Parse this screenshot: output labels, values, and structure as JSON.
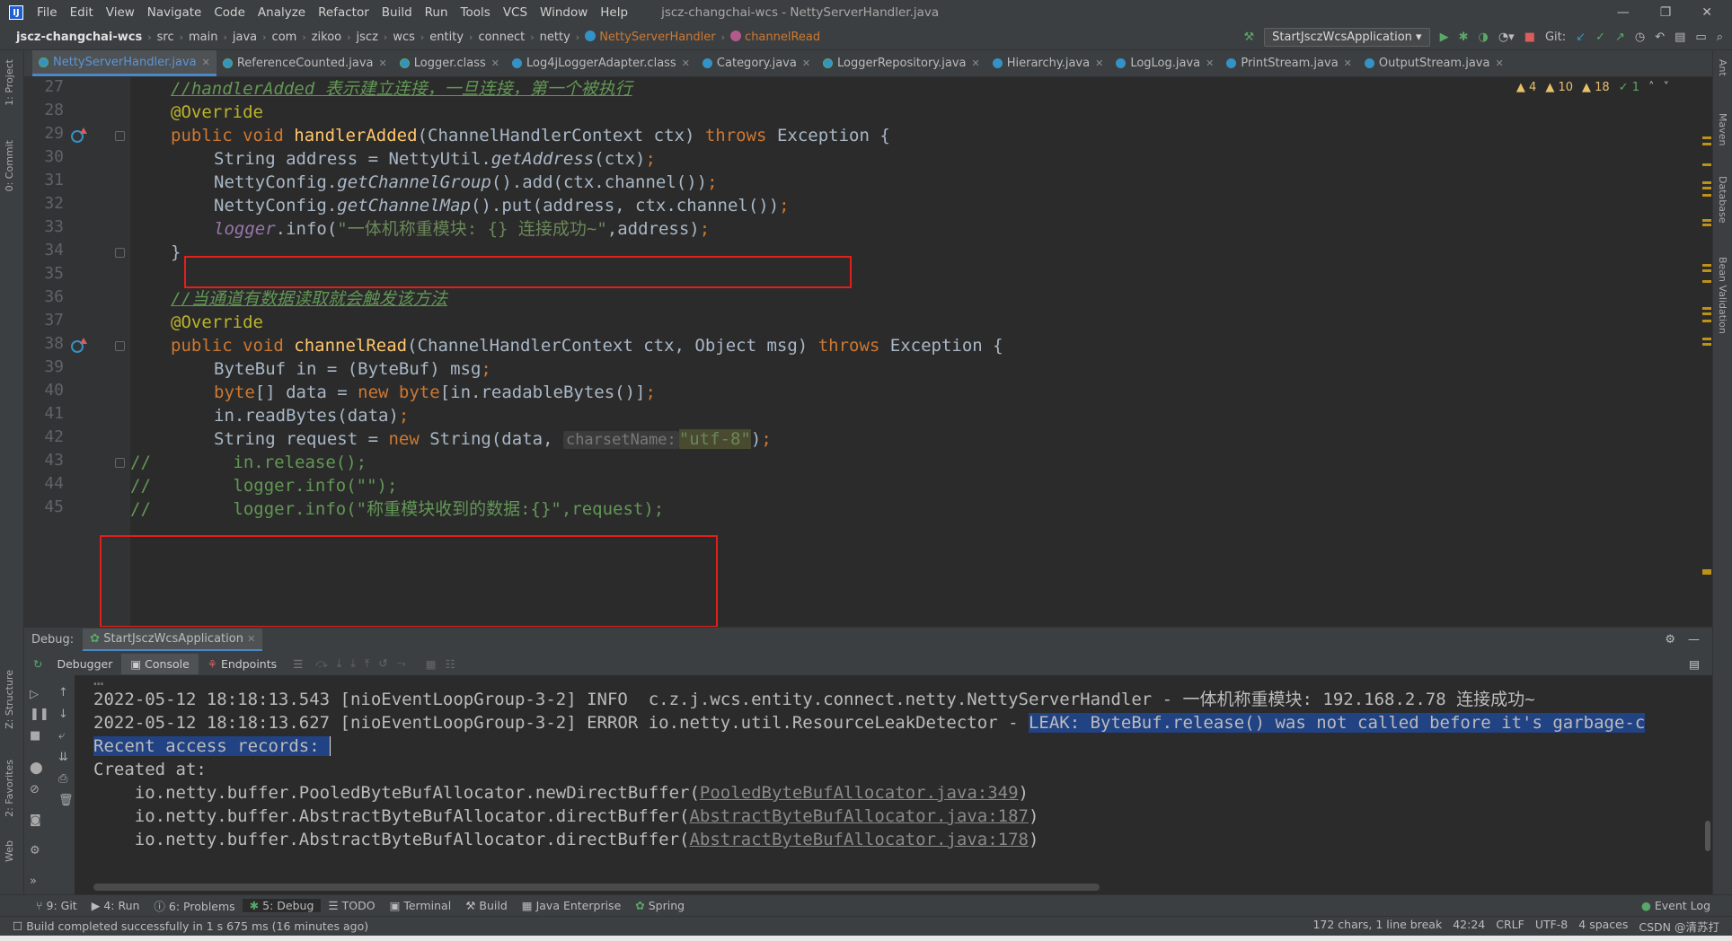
{
  "menubar": {
    "logo": "IJ",
    "items": [
      "File",
      "Edit",
      "View",
      "Navigate",
      "Code",
      "Analyze",
      "Refactor",
      "Build",
      "Run",
      "Tools",
      "VCS",
      "Window",
      "Help"
    ],
    "window_title": "jscz-changchai-wcs - NettyServerHandler.java"
  },
  "navbar": {
    "project": "jscz-changchai-wcs",
    "crumbs": [
      "src",
      "main",
      "java",
      "com",
      "zikoo",
      "jscz",
      "wcs",
      "entity",
      "connect",
      "netty"
    ],
    "class_crumb": "NettyServerHandler",
    "method_crumb": "channelRead",
    "run_config": "StartJsczWcsApplication",
    "git_label": "Git:"
  },
  "tabs": [
    {
      "label": "NettyServerHandler.java",
      "active": true
    },
    {
      "label": "ReferenceCounted.java"
    },
    {
      "label": "Logger.class"
    },
    {
      "label": "Log4jLoggerAdapter.class"
    },
    {
      "label": "Category.java"
    },
    {
      "label": "LoggerRepository.java"
    },
    {
      "label": "Hierarchy.java"
    },
    {
      "label": "LogLog.java"
    },
    {
      "label": "PrintStream.java"
    },
    {
      "label": "OutputStream.java"
    }
  ],
  "inspection": {
    "warnings": "4",
    "weak_warnings": "10",
    "typos": "18",
    "ok": "1"
  },
  "left_strip": {
    "project": "1: Project",
    "commit": "0: Commit",
    "structure": "Z: Structure",
    "favorites": "2: Favorites",
    "web": "Web"
  },
  "right_strip": {
    "ant": "Ant",
    "maven": "Maven",
    "database": "Database",
    "bean": "Bean Validation"
  },
  "code": {
    "lines": [
      "27",
      "28",
      "29",
      "30",
      "31",
      "32",
      "33",
      "34",
      "35",
      "36",
      "37",
      "38",
      "39",
      "40",
      "41",
      "42",
      "43",
      "44",
      "45"
    ],
    "l27": "//handlerAdded 表示建立连接，一旦连接，第一个被执行",
    "l28": "@Override",
    "l29_a": "public void ",
    "l29_fn": "handlerAdded",
    "l29_b": "(ChannelHandlerContext ctx) ",
    "l29_kw": "throws",
    "l29_c": " Exception {",
    "l30_a": "String address = NettyUtil.",
    "l30_m": "getAddress",
    "l30_b": "(ctx)",
    "l30_semi": ";",
    "l31_a": "NettyConfig.",
    "l31_m": "getChannelGroup",
    "l31_b": "().add(ctx.channel())",
    "l31_semi": ";",
    "l32_a": "NettyConfig.",
    "l32_m": "getChannelMap",
    "l32_b": "().put(address, ctx.channel())",
    "l32_semi": ";",
    "l33_f": "logger",
    "l33_a": ".info(",
    "l33_s": "\"一体机称重模块: {} 连接成功~\"",
    "l33_b": ",address)",
    "l33_semi": ";",
    "l34": "}",
    "l36": "//当通道有数据读取就会触发该方法",
    "l37": "@Override",
    "l38_a": "public void ",
    "l38_fn": "channelRead",
    "l38_b": "(ChannelHandlerContext ctx, Object msg) ",
    "l38_kw": "throws",
    "l38_c": " Exception {",
    "l39_a": "ByteBuf in = (ByteBuf) msg",
    "l39_semi": ";",
    "l40_kw": "byte",
    "l40_a": "[] data = ",
    "l40_new": "new",
    "l40_kw2": " byte",
    "l40_b": "[in.readableBytes()]",
    "l40_semi": ";",
    "l41_a": "in.readBytes(data)",
    "l41_semi": ";",
    "l42_a": "String request = ",
    "l42_new": "new",
    "l42_b": " String(data, ",
    "l42_hint": "charsetName:",
    "l42_s": "\"utf-8\"",
    "l42_c": ")",
    "l42_semi": ";",
    "l43": "//        in.release();",
    "l44": "//        logger.info(\"\");",
    "l45": "//        logger.info(\"称重模块收到的数据:{}\",request);"
  },
  "debug": {
    "label": "Debug:",
    "session": "StartJsczWcsApplication",
    "tabs": [
      "Debugger",
      "Console",
      "Endpoints"
    ]
  },
  "console": {
    "line1": "2022-05-12 18:18:13.543 [nioEventLoopGroup-3-2] INFO  c.z.j.wcs.entity.connect.netty.NettyServerHandler - 一体机称重模块: 192.168.2.78 连接成功~",
    "line2_a": "2022-05-12 18:18:13.627 [nioEventLoopGroup-3-2] ERROR io.netty.util.ResourceLeakDetector - ",
    "line2_sel": "LEAK: ByteBuf.release() was not called before it's garbage-c",
    "line3_sel": "Recent access records: ",
    "line4": "Created at:",
    "line5_a": "    io.netty.buffer.PooledByteBufAllocator.newDirectBuffer(",
    "line5_link": "PooledByteBufAllocator.java:349",
    "line5_b": ")",
    "line6_a": "    io.netty.buffer.AbstractByteBufAllocator.directBuffer(",
    "line6_link": "AbstractByteBufAllocator.java:187",
    "line6_b": ")",
    "line7_a": "    io.netty.buffer.AbstractByteBufAllocator.directBuffer(",
    "line7_link": "AbstractByteBufAllocator.java:178",
    "line7_b": ")"
  },
  "bottom_tools": [
    "9: Git",
    "4: Run",
    "6: Problems",
    "5: Debug",
    "TODO",
    "Terminal",
    "Build",
    "Java Enterprise",
    "Spring"
  ],
  "event_log": "Event Log",
  "status": {
    "message": "Build completed successfully in 1 s 675 ms (16 minutes ago)",
    "chars": "172 chars, 1 line break",
    "position": "42:24",
    "line_sep": "CRLF",
    "encoding": "UTF-8",
    "indent": "4 spaces",
    "watermark": "CSDN @清苏打"
  }
}
